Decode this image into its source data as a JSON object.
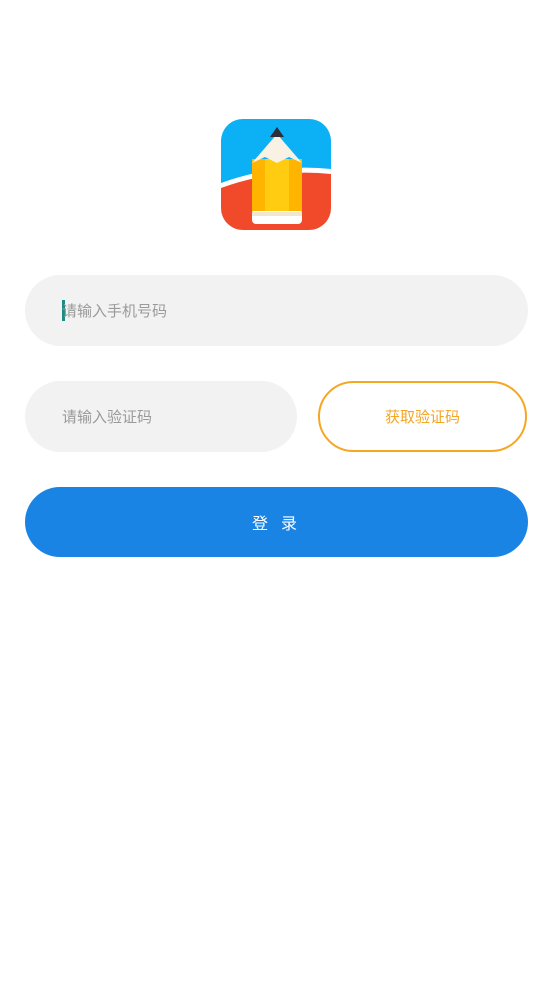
{
  "app": {
    "logo_icon": "pencil-app-logo-icon"
  },
  "form": {
    "phone_placeholder": "请输入手机号码",
    "code_placeholder": "请输入验证码",
    "get_code_label": "获取验证码",
    "login_label": "登 录"
  },
  "colors": {
    "primary": "#1a84e4",
    "accent": "#f5a623",
    "input_bg": "#f2f2f2",
    "placeholder": "#9a9a9a",
    "caret": "#1a8c86",
    "logo_sky": "#0bb0f5",
    "logo_red": "#f04a2b",
    "logo_pencil": "#ffcc12"
  }
}
